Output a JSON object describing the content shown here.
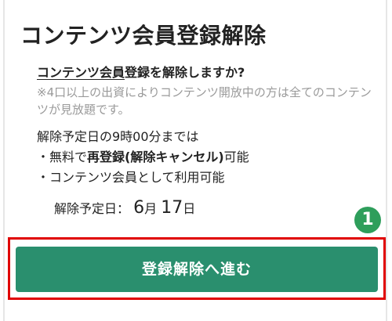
{
  "title": "コンテンツ会員登録解除",
  "question": {
    "underlined": "コンテンツ会員",
    "rest": "登録を解除しますか?"
  },
  "note": "※4口以上の出資によりコンテンツ開放中の方は全てのコンテンツが見放題です。",
  "schedule": {
    "intro": "解除予定日の9時00分までは",
    "item1_prefix": "・無料で",
    "item1_bold": "再登録(解除キャンセル)",
    "item1_suffix": "可能",
    "item2": "・コンテンツ会員として利用可能"
  },
  "date": {
    "label": "解除予定日：",
    "month_num": "6",
    "month_unit": "月",
    "day_num": "17",
    "day_unit": "日"
  },
  "step_badge": "1",
  "button_label": "登録解除へ進む",
  "colors": {
    "button": "#2a8f6e",
    "badge": "#2e9e5b",
    "highlight": "#e00000",
    "note_text": "#9a9a9a"
  }
}
